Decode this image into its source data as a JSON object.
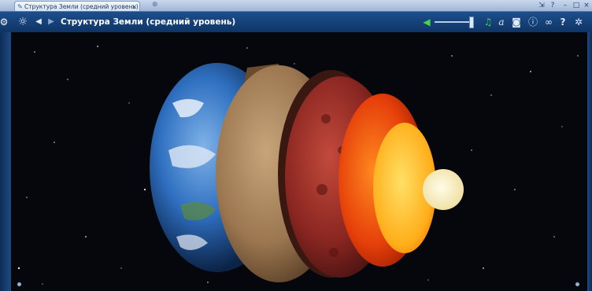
{
  "tab": {
    "label": "Структура Земли (средний уровень)",
    "icon": "pencil-icon"
  },
  "window_controls": [
    "?",
    "?",
    "–",
    "×"
  ],
  "toolbar": {
    "title": "Структура Земли (средний уровень)",
    "icons": [
      "settings-sun-icon",
      "back-icon",
      "forward-icon",
      "speaker-icon",
      "music-icon",
      "text-icon",
      "camera-icon",
      "info-icon",
      "link-icon",
      "help-icon",
      "gear-icon"
    ],
    "volume": 1.0
  },
  "colors": {
    "toolbar": "#163f74",
    "accent_green": "#49d14a",
    "space": "#05070c"
  }
}
